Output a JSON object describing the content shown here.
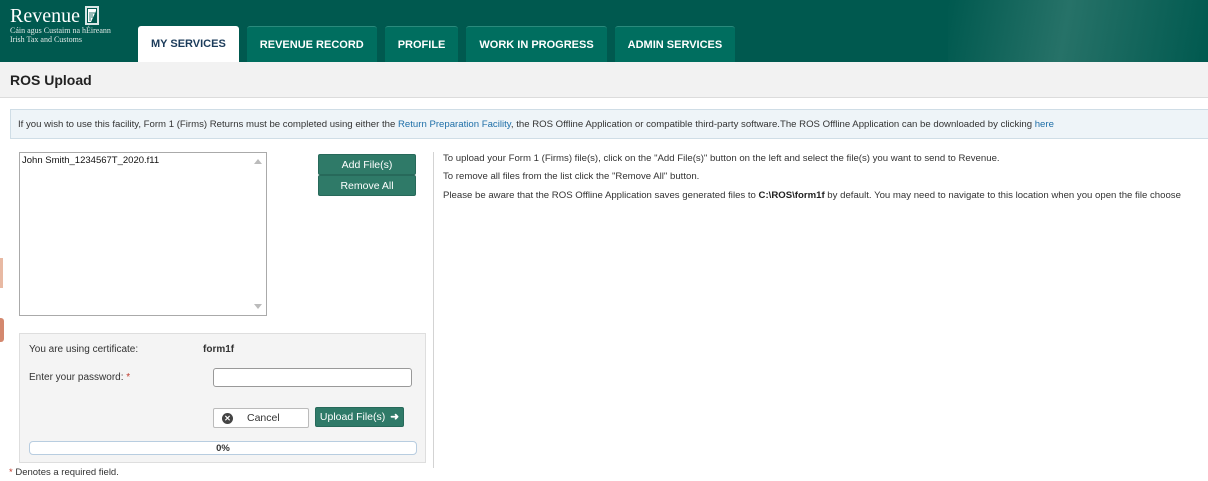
{
  "logo": {
    "name": "Revenue",
    "line1": "Cáin agus Custaim na hÉireann",
    "line2": "Irish Tax and Customs"
  },
  "tabs": [
    {
      "label": "MY SERVICES",
      "active": true
    },
    {
      "label": "REVENUE RECORD",
      "active": false
    },
    {
      "label": "PROFILE",
      "active": false
    },
    {
      "label": "WORK IN PROGRESS",
      "active": false
    },
    {
      "label": "ADMIN SERVICES",
      "active": false
    }
  ],
  "page_title": "ROS Upload",
  "info": {
    "text1": "If you wish to use this facility, Form 1 (Firms) Returns must be completed using either the ",
    "link1": "Return Preparation Facility",
    "text2": ", the ROS Offline Application or compatible third-party software.The ROS Offline Application can be downloaded by clicking ",
    "link2": "here"
  },
  "file_list": {
    "items": [
      "John Smith_1234567T_2020.f11"
    ]
  },
  "buttons": {
    "add_files": "Add File(s)",
    "remove_all": "Remove All",
    "cancel": "Cancel",
    "upload": "Upload File(s)"
  },
  "instructions": {
    "line1": "To upload your Form 1 (Firms) file(s), click on the \"Add File(s)\" button on the left and select the file(s) you want to send to Revenue.",
    "line2": "To remove all files from the list click the \"Remove All\" button.",
    "line3_pre": "Please be aware that the ROS Offline Application saves generated files to ",
    "line3_path": "C:\\ROS\\form1f",
    "line3_post": " by default. You may need to navigate to this location when you open the file choose"
  },
  "certificate": {
    "label": "You are using certificate:",
    "value": "form1f",
    "password_label": "Enter your password: ",
    "required_mark": "*",
    "password_value": ""
  },
  "progress": {
    "percent": 0,
    "label": "0%"
  },
  "footnote": {
    "mark": "*",
    "text": " Denotes a required field."
  },
  "colors": {
    "header": "#00594f",
    "button": "#2f7a68",
    "link": "#1f6fa8"
  }
}
